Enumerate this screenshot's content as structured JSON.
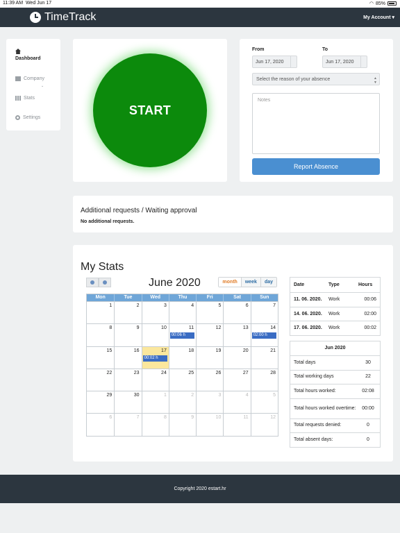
{
  "statusbar": {
    "time": "11:39 AM",
    "date": "Wed Jun 17",
    "battery": "85%"
  },
  "navbar": {
    "brand": "TimeTrack",
    "account": "My Account ▾"
  },
  "sidebar": {
    "items": [
      {
        "label": "Dashboard",
        "icon": "home-icon"
      },
      {
        "label": "Company",
        "icon": "building-icon"
      },
      {
        "label": "Stats",
        "icon": "bar-chart-icon"
      },
      {
        "label": "Settings",
        "icon": "gear-icon"
      }
    ]
  },
  "start": {
    "label": "START"
  },
  "absence": {
    "from_label": "From",
    "to_label": "To",
    "from_value": "Jun 17, 2020",
    "to_value": "Jun 17, 2020",
    "reason_placeholder": "Select the reason of your absence",
    "notes_placeholder": "Notes",
    "report_label": "Report Absence"
  },
  "requests": {
    "title": "Additional requests / Waiting approval",
    "text": "No additional requests."
  },
  "stats": {
    "title": "My Stats",
    "calendar": {
      "month_title": "June 2020",
      "views": [
        "month",
        "week",
        "day"
      ],
      "weekdays": [
        "Mon",
        "Tue",
        "Wed",
        "Thu",
        "Fri",
        "Sat",
        "Sun"
      ],
      "weeks": [
        [
          "1",
          "2",
          "3",
          "4",
          "5",
          "6",
          "7"
        ],
        [
          "8",
          "9",
          "10",
          "11",
          "12",
          "13",
          "14"
        ],
        [
          "15",
          "16",
          "17",
          "18",
          "19",
          "20",
          "21"
        ],
        [
          "22",
          "23",
          "24",
          "25",
          "26",
          "27",
          "28"
        ],
        [
          "29",
          "30",
          "1",
          "2",
          "3",
          "4",
          "5"
        ],
        [
          "6",
          "7",
          "8",
          "9",
          "10",
          "11",
          "12"
        ]
      ],
      "events": [
        {
          "label": "00:06 h"
        },
        {
          "label": "02:00 h"
        },
        {
          "label": "00:02 h"
        }
      ]
    },
    "entries": {
      "headers": [
        "Date",
        "Type",
        "Hours"
      ],
      "rows": [
        [
          "11. 06. 2020.",
          "Work",
          "00:06"
        ],
        [
          "14. 06. 2020.",
          "Work",
          "02:00"
        ],
        [
          "17. 06. 2020.",
          "Work",
          "00:02"
        ]
      ]
    },
    "summary": {
      "title": "Jun 2020",
      "rows": [
        [
          "Total days",
          "30"
        ],
        [
          "Total working days",
          "22"
        ],
        [
          "Total hours worked:",
          "02:08"
        ],
        [
          "Total hours worked overtime:",
          "00:00"
        ],
        [
          "Total requests denied:",
          "0"
        ],
        [
          "Total absent days:",
          "0"
        ]
      ]
    }
  },
  "footer": {
    "text": "Copyright 2020 estart.hr"
  }
}
